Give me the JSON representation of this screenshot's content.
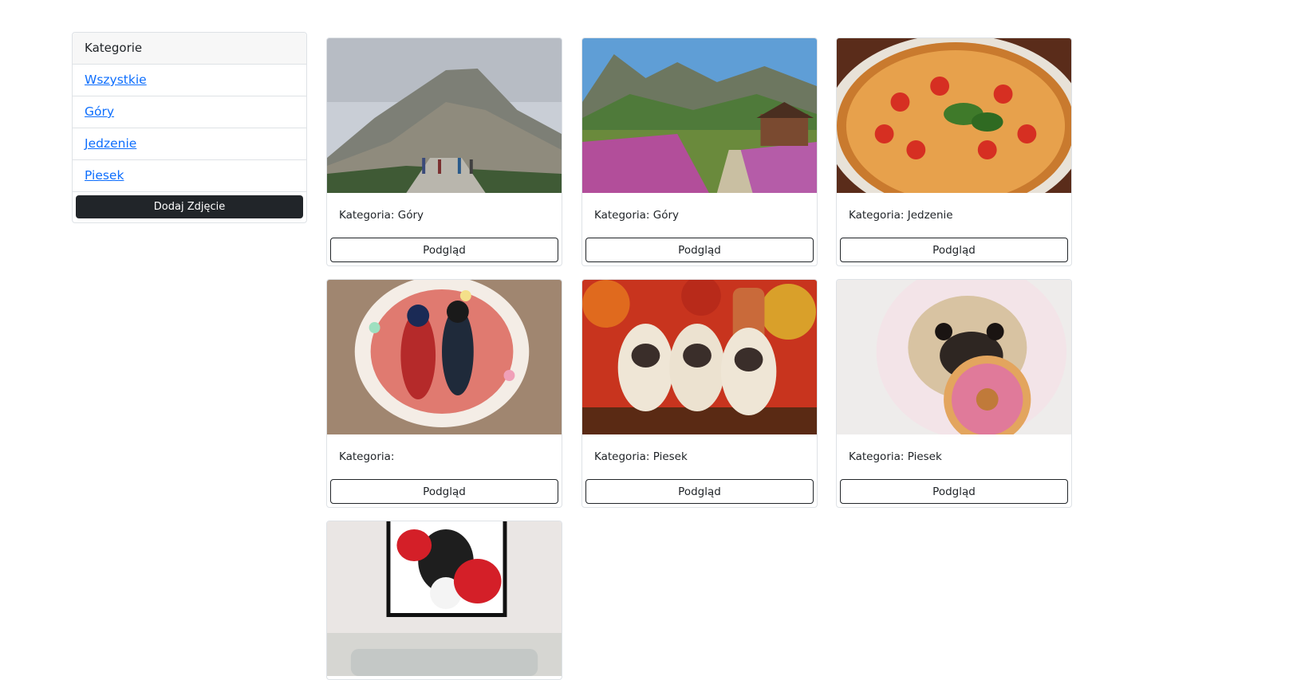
{
  "sidebar": {
    "header": "Kategorie",
    "items": [
      {
        "label": "Wszystkie"
      },
      {
        "label": "Góry"
      },
      {
        "label": "Jedzenie"
      },
      {
        "label": "Piesek"
      }
    ],
    "add_button": "Dodaj Zdjęcie"
  },
  "gallery": {
    "cards": [
      {
        "category_text": "Kategoria: Góry",
        "button": "Podgląd",
        "image": "mountain-trail-image"
      },
      {
        "category_text": "Kategoria: Góry",
        "button": "Podgląd",
        "image": "mountain-meadow-image"
      },
      {
        "category_text": "Kategoria: Jedzenie",
        "button": "Podgląd",
        "image": "pizza-image"
      },
      {
        "category_text": "Kategoria:",
        "button": "Podgląd",
        "image": "birthday-cake-image"
      },
      {
        "category_text": "Kategoria: Piesek",
        "button": "Podgląd",
        "image": "pug-puppies-image"
      },
      {
        "category_text": "Kategoria: Piesek",
        "button": "Podgląd",
        "image": "pug-donut-image"
      },
      {
        "category_text": "",
        "button": "",
        "image": "boxing-dog-poster-image"
      }
    ]
  }
}
